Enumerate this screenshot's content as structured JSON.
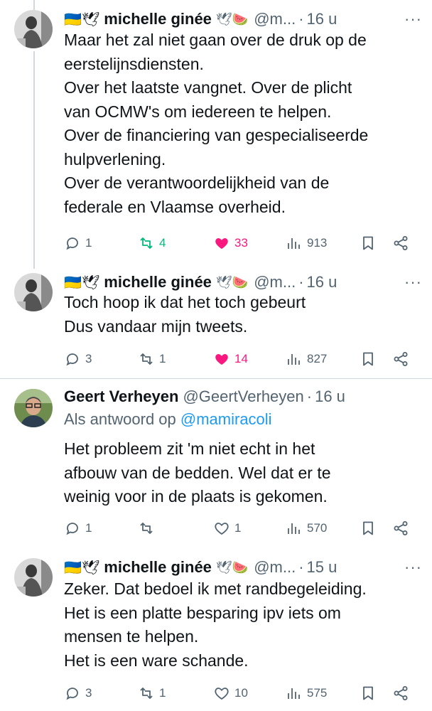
{
  "tweets": [
    {
      "name": "michelle ginée",
      "flag": "🇺🇦🕊",
      "badges": "🕊🍉",
      "handle": "@m...",
      "sep": "·",
      "time": "16 u",
      "lines": [
        "Maar het zal niet gaan over de druk op de",
        "eerstelijnsdiensten.",
        "Over het laatste vangnet. Over de plicht",
        "van OCMW's om iedereen te helpen.",
        "Over de financiering van gespecialiseerde",
        "hulpverlening.",
        "Over de verantwoordelijkheid van de",
        "federale en Vlaamse overheid."
      ],
      "replies": "1",
      "retweets": "4",
      "likes": "33",
      "views": "913"
    },
    {
      "name": "michelle ginée",
      "flag": "🇺🇦🕊",
      "badges": "🕊🍉",
      "handle": "@m...",
      "sep": "·",
      "time": "16 u",
      "lines": [
        "Toch hoop ik dat het toch gebeurt",
        "Dus vandaar mijn tweets."
      ],
      "replies": "3",
      "retweets": "1",
      "likes": "14",
      "views": "827"
    },
    {
      "name": "Geert Verheyen",
      "handle": "@GeertVerheyen",
      "sep": "·",
      "time": "16 u",
      "reply_prefix": "Als antwoord op",
      "reply_handle": "@mamiracoli",
      "lines": [
        "Het probleem zit 'm niet echt in het",
        "afbouw van de bedden. Wel dat er te",
        "weinig voor in de plaats is gekomen."
      ],
      "replies": "1",
      "retweets": "",
      "likes": "1",
      "views": "570"
    },
    {
      "name": "michelle ginée",
      "flag": "🇺🇦🕊",
      "badges": "🕊🍉",
      "handle": "@m...",
      "sep": "·",
      "time": "15 u",
      "lines": [
        "Zeker. Dat bedoel ik met randbegeleiding.",
        "Het is een platte besparing ipv iets om",
        "mensen te helpen.",
        "Het is een ware schande."
      ],
      "replies": "3",
      "retweets": "1",
      "likes": "10",
      "views": "575"
    }
  ],
  "more_label": "···",
  "colors": {
    "accent": "#1d9bf0",
    "like": "#f91880",
    "retweet": "#00ba7c",
    "muted": "#536471"
  }
}
